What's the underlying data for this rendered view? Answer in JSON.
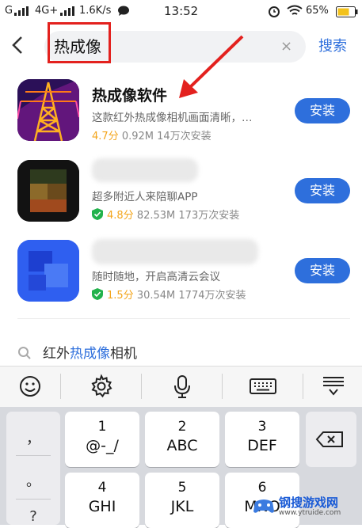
{
  "status_bar": {
    "carrier_left": "G",
    "network": "4G+",
    "speed": "1.6K/s",
    "time": "13:52",
    "battery": "65%"
  },
  "search": {
    "query": "热成像",
    "clear_label": "×",
    "search_label": "搜索"
  },
  "apps": [
    {
      "name": "热成像软件",
      "description": "这款红外热成像相机画面清晰，…",
      "score": "4.7分",
      "size": "0.92M",
      "installs": "14万次安装",
      "install_label": "安装"
    },
    {
      "name": "",
      "description": "超多附近人来陪聊APP",
      "score": "4.8分",
      "size": "82.53M",
      "installs": "173万次安装",
      "install_label": "安装"
    },
    {
      "name": "",
      "description": "随时随地，开启高清云会议",
      "score": "1.5分",
      "size": "30.54M",
      "installs": "1774万次安装",
      "install_label": "安装"
    }
  ],
  "suggestion": {
    "prefix": "红外",
    "highlight": "热成像",
    "suffix": "相机"
  },
  "keyboard": {
    "side_keys": [
      "，",
      "。",
      "?"
    ],
    "keys": [
      {
        "num": "1",
        "letters": "@-_/"
      },
      {
        "num": "2",
        "letters": "ABC"
      },
      {
        "num": "3",
        "letters": "DEF"
      },
      {
        "num": "4",
        "letters": "GHI"
      },
      {
        "num": "5",
        "letters": "JKL"
      },
      {
        "num": "6",
        "letters": "MNO"
      }
    ]
  },
  "watermark": {
    "title": "钢搜游戏网",
    "url": "www.ytruide.com"
  },
  "colors": {
    "accent": "#2e6fdc",
    "score": "#f3a51b",
    "annotation_red": "#e3211e",
    "verified_green": "#22b24c"
  }
}
